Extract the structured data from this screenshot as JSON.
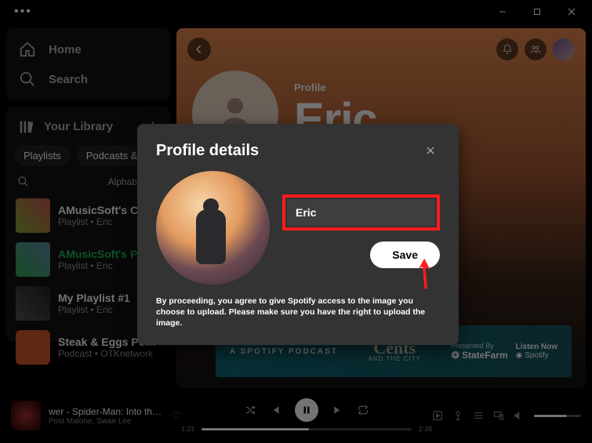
{
  "window": {
    "more": "•••"
  },
  "nav": {
    "home": "Home",
    "search": "Search"
  },
  "library": {
    "title": "Your Library",
    "chips": [
      "Playlists",
      "Podcasts & Shows"
    ],
    "sort": "Alphabetical",
    "items": [
      {
        "title": "AMusicSoft's Christmas",
        "sub": "Playlist • Eric"
      },
      {
        "title": "AMusicSoft's Playlist",
        "sub": "Playlist • Eric"
      },
      {
        "title": "My Playlist #1",
        "sub": "Playlist • Eric"
      },
      {
        "title": "Steak & Eggs Podcast",
        "sub": "Podcast • OTKnetwork"
      }
    ]
  },
  "profile": {
    "label": "Profile",
    "name": "Eric"
  },
  "banner": {
    "left": "A SPOTIFY PODCAST",
    "center_top": "Cents",
    "center_bot": "CITY",
    "presented": "Presented By",
    "sponsor": "StateFarm",
    "listen": "Listen Now",
    "spotify": "Spotify"
  },
  "player": {
    "track": "wer - Spider-Man: Into the Sp",
    "artist": "Post Malone, Swae Lee",
    "current": "1:21",
    "total": "2:38",
    "progress_pct": 51
  },
  "modal": {
    "title": "Profile details",
    "name_value": "Eric",
    "save": "Save",
    "disclaimer": "By proceeding, you agree to give Spotify access to the image you choose to upload. Please make sure you have the right to upload the image."
  }
}
